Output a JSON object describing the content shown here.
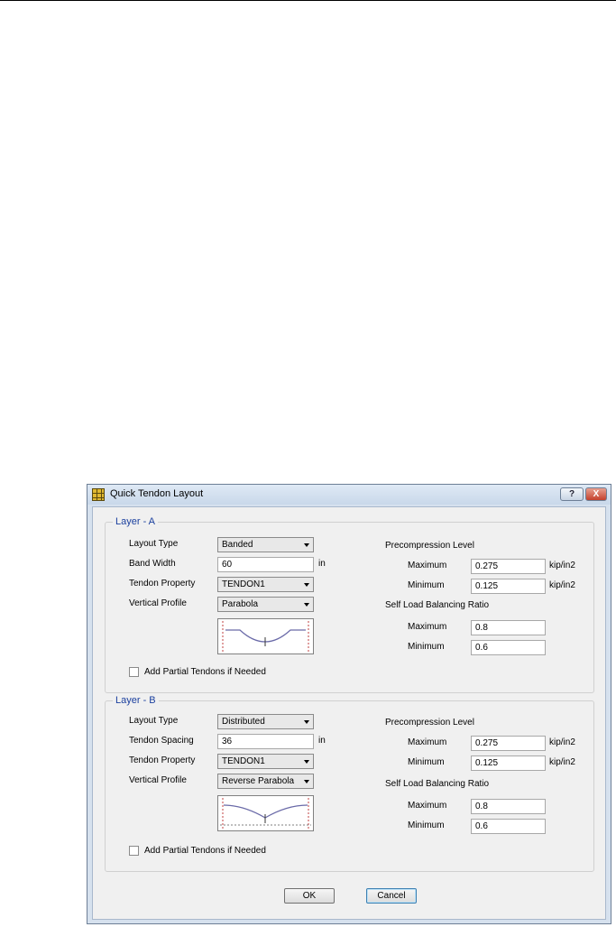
{
  "window": {
    "title": "Quick Tendon Layout",
    "help_label": "?",
    "close_label": "X"
  },
  "layer_a": {
    "legend": "Layer - A",
    "layout_type_label": "Layout Type",
    "layout_type_value": "Banded",
    "width_label": "Band Width",
    "width_value": "60",
    "width_unit": "in",
    "tendon_property_label": "Tendon Property",
    "tendon_property_value": "TENDON1",
    "vertical_profile_label": "Vertical Profile",
    "vertical_profile_value": "Parabola",
    "partial_tendons_label": "Add Partial Tendons if Needed",
    "precompression_label": "Precompression Level",
    "precomp_max_label": "Maximum",
    "precomp_max_value": "0.275",
    "precomp_max_unit": "kip/in2",
    "precomp_min_label": "Minimum",
    "precomp_min_value": "0.125",
    "precomp_min_unit": "kip/in2",
    "self_load_label": "Self Load Balancing Ratio",
    "self_max_label": "Maximum",
    "self_max_value": "0.8",
    "self_min_label": "Minimum",
    "self_min_value": "0.6"
  },
  "layer_b": {
    "legend": "Layer - B",
    "layout_type_label": "Layout Type",
    "layout_type_value": "Distributed",
    "width_label": "Tendon Spacing",
    "width_value": "36",
    "width_unit": "in",
    "tendon_property_label": "Tendon Property",
    "tendon_property_value": "TENDON1",
    "vertical_profile_label": "Vertical Profile",
    "vertical_profile_value": "Reverse Parabola",
    "partial_tendons_label": "Add Partial Tendons if Needed",
    "precompression_label": "Precompression Level",
    "precomp_max_label": "Maximum",
    "precomp_max_value": "0.275",
    "precomp_max_unit": "kip/in2",
    "precomp_min_label": "Minimum",
    "precomp_min_value": "0.125",
    "precomp_min_unit": "kip/in2",
    "self_load_label": "Self Load Balancing Ratio",
    "self_max_label": "Maximum",
    "self_max_value": "0.8",
    "self_min_label": "Minimum",
    "self_min_value": "0.6"
  },
  "buttons": {
    "ok_label": "OK",
    "cancel_label": "Cancel"
  },
  "colors": {
    "legend": "#1a3f9e",
    "profile_curve": "#6a6aa8",
    "profile_support": "#c04040"
  },
  "icons": {
    "app": "tendon-grid-icon",
    "dropdown": "chevron-down-icon"
  }
}
